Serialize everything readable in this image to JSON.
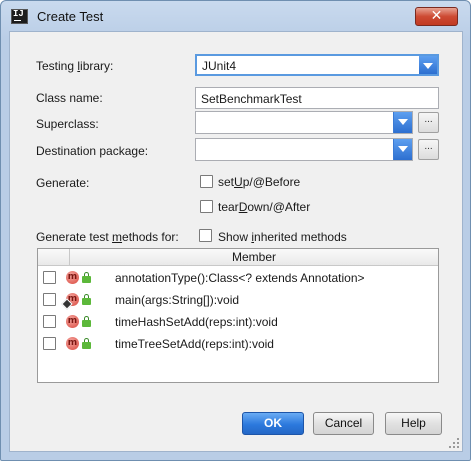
{
  "window": {
    "title": "Create Test",
    "icon_text": "IJ"
  },
  "form": {
    "testing_library": {
      "label_prefix": "Testing ",
      "label_mnemonic": "l",
      "label_suffix": "ibrary:",
      "value": "JUnit4"
    },
    "class_name": {
      "label": "Class name:",
      "value": "SetBenchmarkTest"
    },
    "superclass": {
      "label": "Superclass:",
      "value": ""
    },
    "destination_package": {
      "label": "Destination package:",
      "value": ""
    },
    "generate": {
      "label": "Generate:",
      "setup": {
        "prefix": "set",
        "mnemonic": "U",
        "suffix": "p/@Before",
        "checked": false
      },
      "teardown": {
        "prefix": "tear",
        "mnemonic": "D",
        "suffix": "own/@After",
        "checked": false
      }
    },
    "methods": {
      "label_prefix": "Generate test ",
      "label_mnemonic": "m",
      "label_suffix": "ethods for:",
      "show_inherited": {
        "prefix": "Show ",
        "mnemonic": "i",
        "suffix": "nherited methods",
        "checked": false
      }
    }
  },
  "table": {
    "header": "Member",
    "rows": [
      {
        "signature": "annotationType():Class<? extends Annotation>",
        "checked": false,
        "static": false,
        "icon": "method-icon"
      },
      {
        "signature": "main(args:String[]):void",
        "checked": false,
        "static": true,
        "icon": "method-icon"
      },
      {
        "signature": "timeHashSetAdd(reps:int):void",
        "checked": false,
        "static": false,
        "icon": "method-icon"
      },
      {
        "signature": "timeTreeSetAdd(reps:int):void",
        "checked": false,
        "static": false,
        "icon": "method-icon"
      }
    ]
  },
  "buttons": {
    "ok": "OK",
    "cancel": "Cancel",
    "help": "Help",
    "close": "✕",
    "browse": "..."
  },
  "colors": {
    "accent": "#2c79dd",
    "method_icon": "#d8453a",
    "lock_icon": "#5cb83a",
    "close_button": "#cd4a33"
  }
}
